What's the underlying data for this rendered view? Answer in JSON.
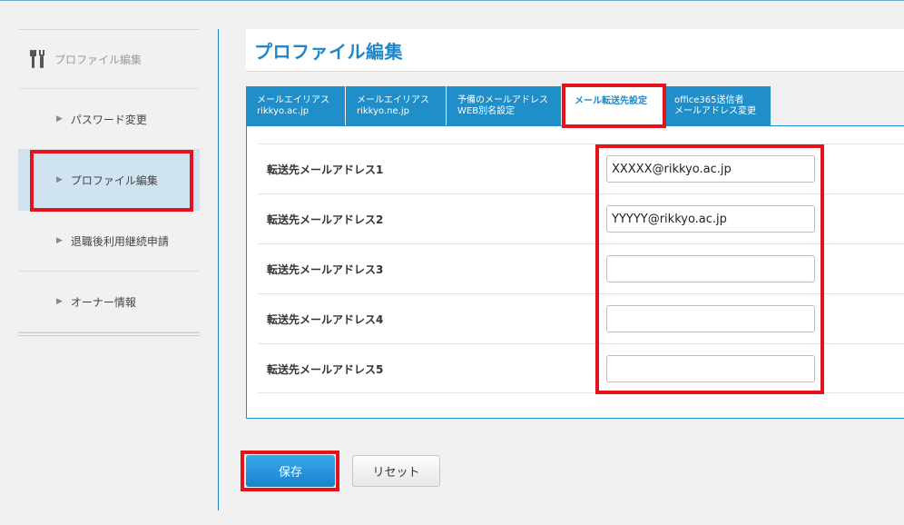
{
  "sidebar": {
    "header": "プロファイル編集",
    "items": [
      {
        "label": "パスワード変更"
      },
      {
        "label": "プロファイル編集"
      },
      {
        "label": "退職後利用継続申請"
      },
      {
        "label": "オーナー情報"
      }
    ]
  },
  "page": {
    "title": "プロファイル編集"
  },
  "tabs": [
    {
      "line1": "メールエイリアス",
      "line2": "rikkyo.ac.jp"
    },
    {
      "line1": "メールエイリアス",
      "line2": "rikkyo.ne.jp"
    },
    {
      "line1": "予備のメールアドレス",
      "line2": "WEB別名設定"
    },
    {
      "line1": "メール転送先設定",
      "line2": ""
    },
    {
      "line1": "office365送信者",
      "line2": "メールアドレス変更"
    }
  ],
  "form": {
    "rows": [
      {
        "label": "転送先メールアドレス1",
        "value": "XXXXX@rikkyo.ac.jp"
      },
      {
        "label": "転送先メールアドレス2",
        "value": "YYYYY@rikkyo.ac.jp"
      },
      {
        "label": "転送先メールアドレス3",
        "value": ""
      },
      {
        "label": "転送先メールアドレス4",
        "value": ""
      },
      {
        "label": "転送先メールアドレス5",
        "value": ""
      }
    ]
  },
  "buttons": {
    "save": "保存",
    "reset": "リセット"
  },
  "colors": {
    "accent": "#1f8ec9",
    "highlight": "#e5111b"
  }
}
